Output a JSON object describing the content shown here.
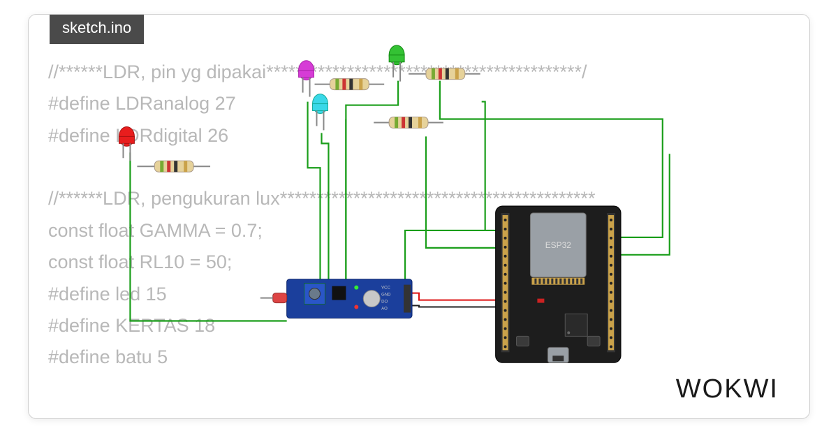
{
  "tab": {
    "filename": "sketch.ino"
  },
  "code": {
    "l1": "//******LDR, pin yg dipakai*******************************************/",
    "l2": "#define LDRanalog 27",
    "l3": "#define LDRdigital 26",
    "l4": "",
    "l5": "//******LDR, pengukuran lux*******************************************",
    "l6": "const float GAMMA = 0.7;",
    "l7": "const float RL10 = 50;",
    "l8": "#define led 15",
    "l9": "#define KERTAS 18",
    "l10": "#define batu 5"
  },
  "brand": "WOKWI",
  "components": {
    "board": "ESP32",
    "sensor": "LDR",
    "led_colors": [
      "red",
      "magenta",
      "cyan",
      "green"
    ],
    "resistors": 4
  }
}
